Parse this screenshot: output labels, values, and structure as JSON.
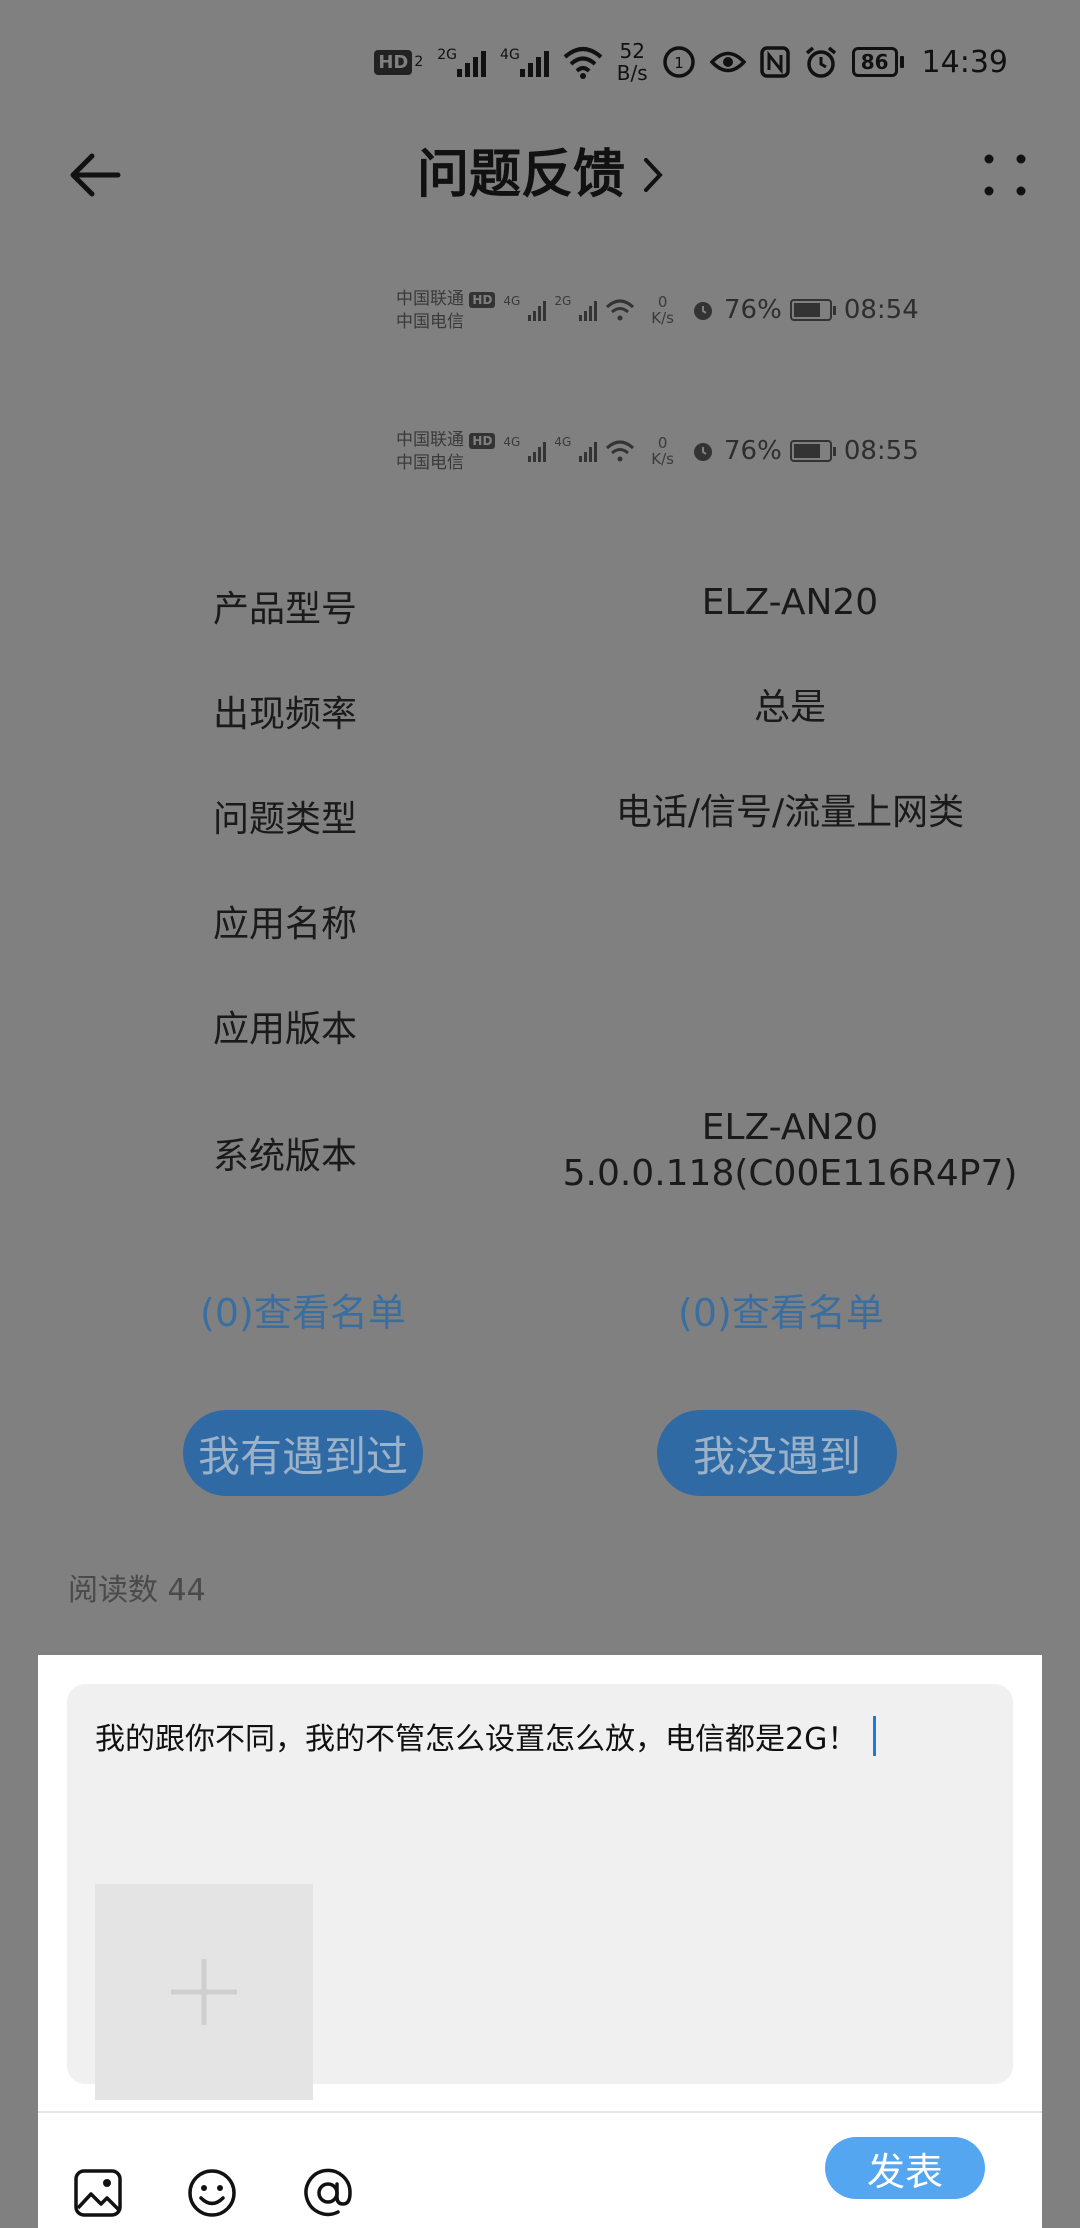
{
  "status_bar": {
    "hd": "HD",
    "sim2": "2",
    "net1": "2G",
    "net2": "4G",
    "speed_value": "52",
    "speed_unit": "B/s",
    "battery": "86",
    "time": "14:39"
  },
  "header": {
    "title": "问题反馈"
  },
  "screenshots": [
    {
      "carrier1": "中国联通",
      "carrier2": "中国电信",
      "hd": "HD",
      "net1": "4G",
      "net2": "2G",
      "speed_value": "0",
      "speed_unit": "K/s",
      "battery": "76%",
      "time": "08:54"
    },
    {
      "carrier1": "中国联通",
      "carrier2": "中国电信",
      "hd": "HD",
      "net1": "4G",
      "net2": "4G",
      "speed_value": "0",
      "speed_unit": "K/s",
      "battery": "76%",
      "time": "08:55"
    }
  ],
  "info": [
    {
      "label": "产品型号",
      "value": "ELZ-AN20"
    },
    {
      "label": "出现频率",
      "value": "总是"
    },
    {
      "label": "问题类型",
      "value": "电话/信号/流量上网类"
    },
    {
      "label": "应用名称",
      "value": ""
    },
    {
      "label": "应用版本",
      "value": ""
    },
    {
      "label": "系统版本",
      "value": "ELZ-AN20",
      "value2": "5.0.0.118(C00E116R4P7)"
    }
  ],
  "votes": {
    "left_link": "(0)查看名单",
    "right_link": "(0)查看名单",
    "left_button": "我有遇到过",
    "right_button": "我没遇到"
  },
  "read_count": "阅读数 44",
  "composer": {
    "text": "我的跟你不同，我的不管怎么设置怎么放，电信都是2G！",
    "publish": "发表"
  },
  "colors": {
    "overlay": "#808080",
    "link": "#3b6ea0",
    "vote_button": "#2f6aa4",
    "publish": "#55a6f0",
    "caret": "#1e7ae0"
  }
}
